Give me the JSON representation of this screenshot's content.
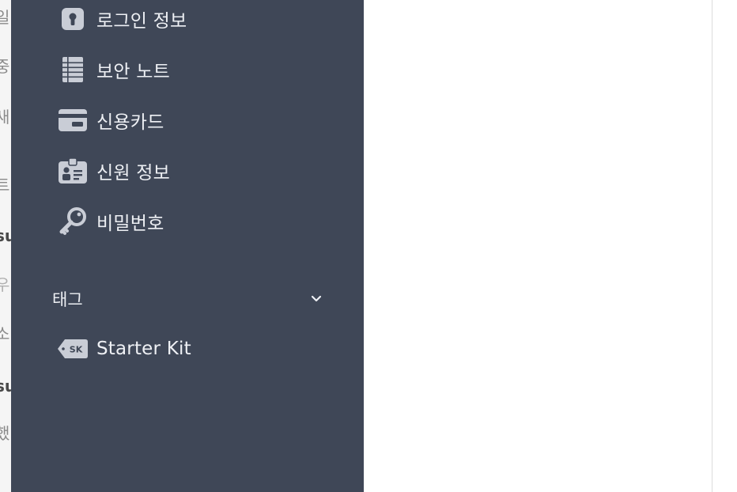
{
  "left_strip": {
    "fragments": [
      "일",
      "중",
      "새",
      "트",
      "su",
      "우",
      "소",
      "su",
      "했"
    ]
  },
  "sidebar": {
    "items": [
      {
        "label": "로그인 정보",
        "icon": "lock-icon"
      },
      {
        "label": "보안 노트",
        "icon": "note-icon"
      },
      {
        "label": "신용카드",
        "icon": "credit-card-icon"
      },
      {
        "label": "신원 정보",
        "icon": "id-card-icon"
      },
      {
        "label": "비밀번호",
        "icon": "key-icon"
      }
    ],
    "tags_header": "태그",
    "tags": [
      {
        "label": "Starter Kit",
        "icon": "tag-icon",
        "badge": "SK"
      }
    ]
  },
  "colors": {
    "sidebar_bg": "#3f4757",
    "sidebar_text": "#eef0f4",
    "icon": "#c9cdd6"
  }
}
